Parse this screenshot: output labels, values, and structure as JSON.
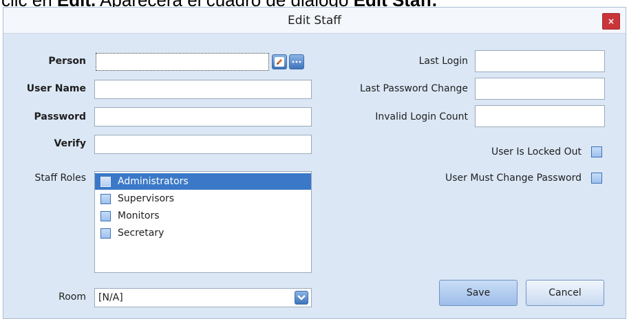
{
  "caption": {
    "prefix": "clic en ",
    "edit": "Edit.",
    "middle": " Aparecerá el cuadro de diálogo ",
    "dialog_name": "Edit Staff."
  },
  "dialog": {
    "title": "Edit Staff",
    "close_label": "×"
  },
  "left_form": {
    "person_label": "Person",
    "username_label": "User Name",
    "password_label": "Password",
    "verify_label": "Verify",
    "roles_label": "Staff Roles",
    "room_label": "Room"
  },
  "roles": [
    {
      "label": "Administrators",
      "selected": true,
      "checked": false
    },
    {
      "label": "Supervisors",
      "selected": false,
      "checked": false
    },
    {
      "label": "Monitors",
      "selected": false,
      "checked": false
    },
    {
      "label": "Secretary",
      "selected": false,
      "checked": false
    }
  ],
  "room": {
    "value": "[N/A]"
  },
  "right_form": {
    "last_login_label": "Last Login",
    "last_password_change_label": "Last Password Change",
    "invalid_login_count_label": "Invalid Login Count",
    "locked_out_label": "User Is Locked Out",
    "must_change_label": "User Must Change Password",
    "locked_out": false,
    "must_change": false
  },
  "buttons": {
    "save": "Save",
    "cancel": "Cancel"
  },
  "colors": {
    "dialog_bg": "#dbe7f5",
    "selection": "#3b79c8",
    "close": "#c9363a"
  }
}
